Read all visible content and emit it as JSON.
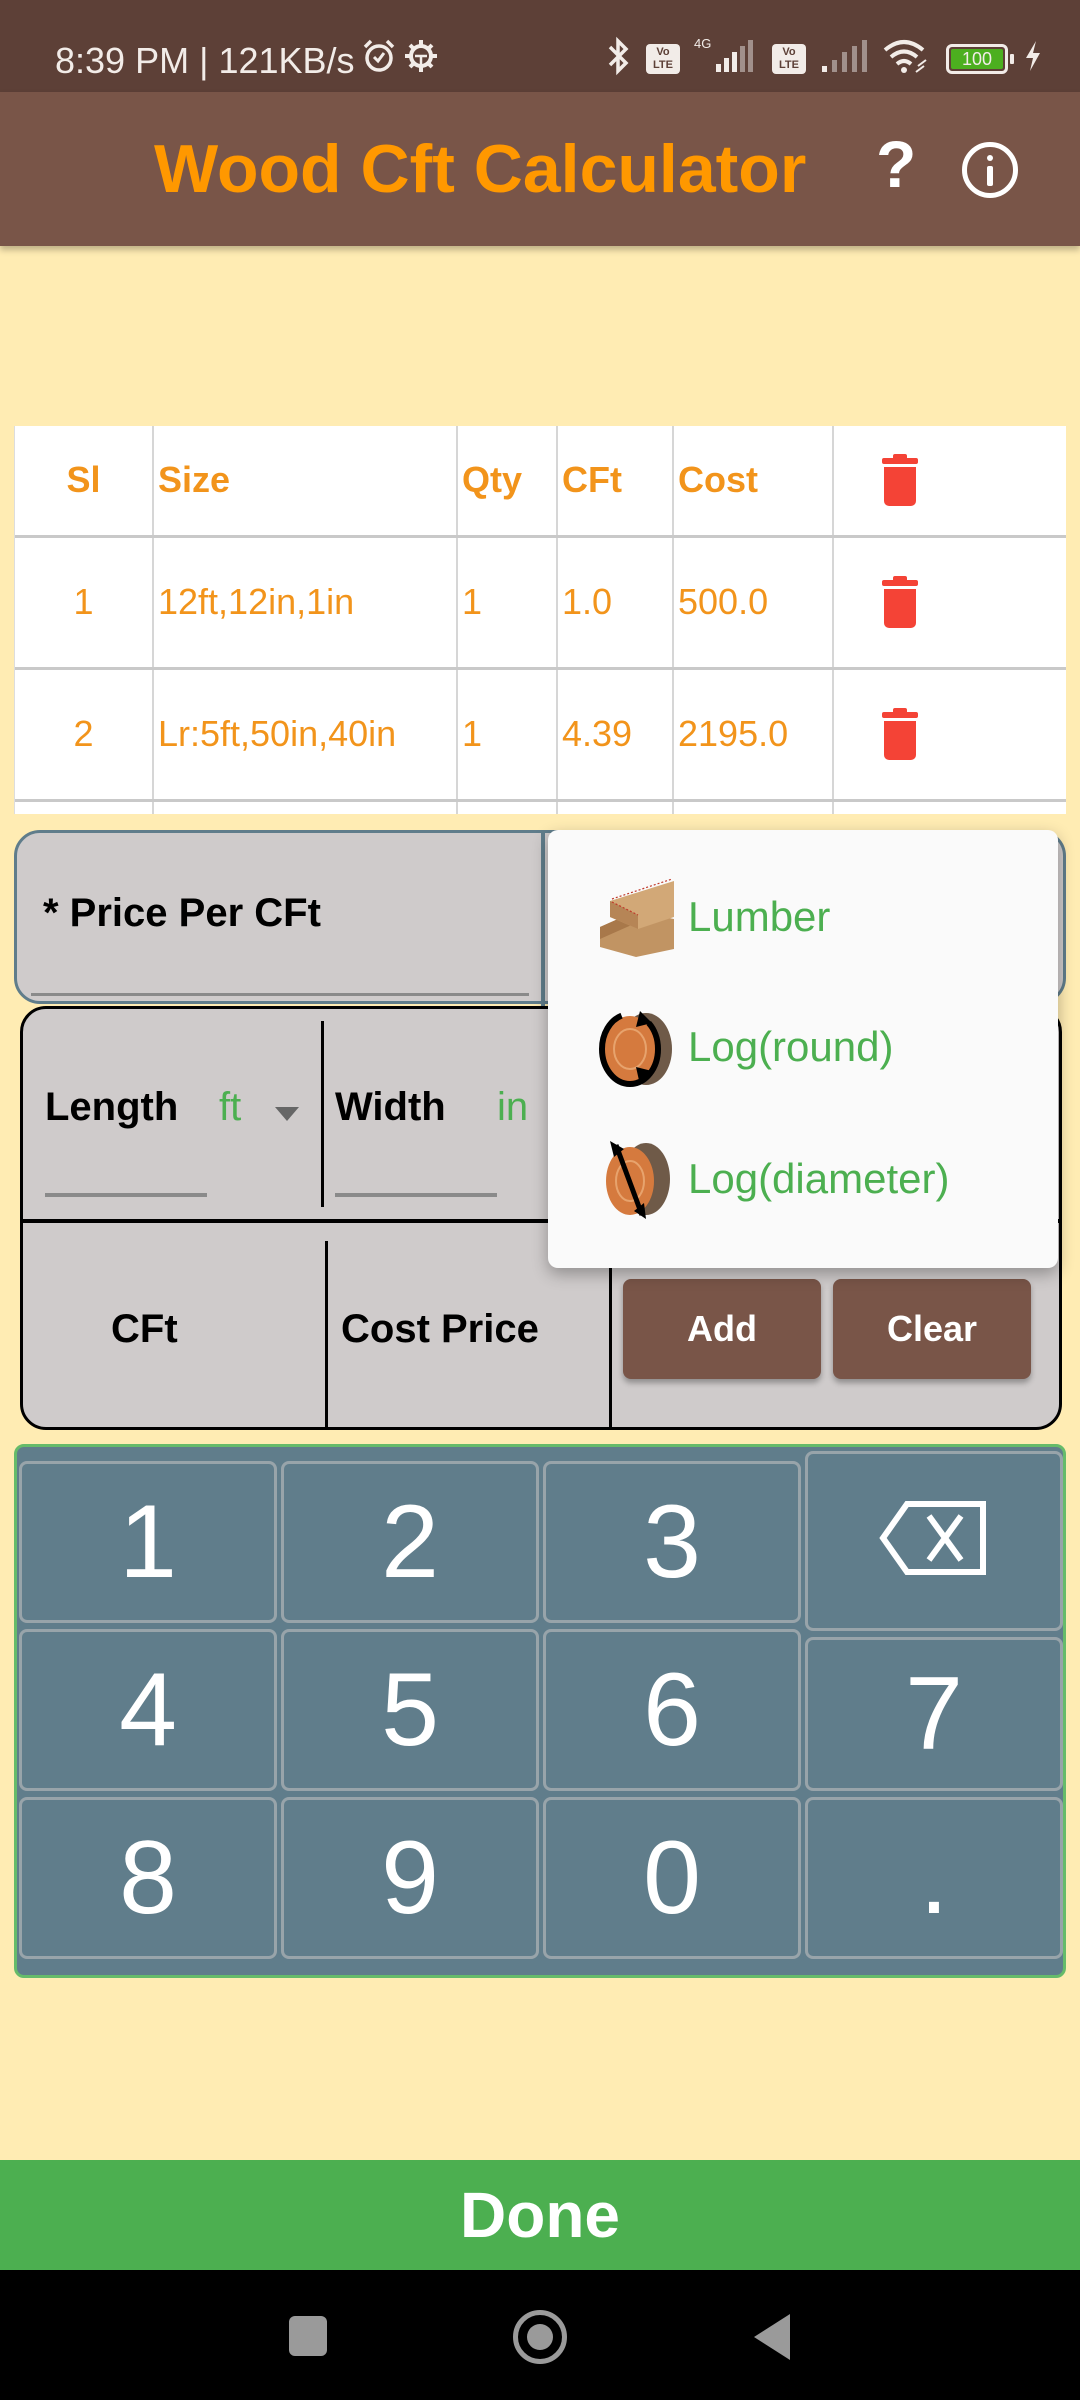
{
  "status_bar": {
    "time": "8:39 PM",
    "separator": "|",
    "network_speed": "121KB/s",
    "left_icons": [
      "alarm-icon",
      "android-debug-icon"
    ],
    "right_icons": [
      "bluetooth-icon",
      "volte-icon",
      "4g-signal-icon",
      "volte-icon",
      "signal-icon",
      "wifi-icon",
      "battery-icon",
      "charging-icon"
    ],
    "network_type": "4G",
    "volte_label_top": "Vo",
    "volte_label_bottom": "LTE",
    "battery_level": "100"
  },
  "app_bar": {
    "title": "Wood Cft Calculator",
    "help_label": "?",
    "help_icon": "help-icon",
    "info_icon": "info-icon"
  },
  "table": {
    "columns": [
      "Sl",
      "Size",
      "Qty",
      "CFt",
      "Cost"
    ],
    "delete_all_icon": "trash-icon",
    "rows": [
      {
        "sl": "1",
        "size": "12ft,12in,1in",
        "qty": "1",
        "cft": "1.0",
        "cost": "500.0"
      },
      {
        "sl": "2",
        "size": "Lr:5ft,50in,40in",
        "qty": "1",
        "cft": "4.39",
        "cost": "2195.0"
      }
    ]
  },
  "price_panel": {
    "label": "* Price Per CFt"
  },
  "dimensions": {
    "length_label": "Length",
    "length_unit": "ft",
    "width_label": "Width",
    "width_unit": "in"
  },
  "results": {
    "cft_label": "CFt",
    "cost_price_label": "Cost Price",
    "add_label": "Add",
    "clear_label": "Clear"
  },
  "wood_type_menu": {
    "items": [
      {
        "label": "Lumber",
        "icon": "lumber-icon"
      },
      {
        "label": "Log(round)",
        "icon": "log-round-icon"
      },
      {
        "label": "Log(diameter)",
        "icon": "log-diameter-icon"
      }
    ]
  },
  "keypad": {
    "keys": [
      "1",
      "2",
      "3",
      "backspace",
      "4",
      "5",
      "6",
      "7",
      "8",
      "9",
      "0",
      "."
    ],
    "backspace_icon": "backspace-icon"
  },
  "done_label": "Done",
  "nav_bar": {
    "icons": [
      "recent-apps-icon",
      "home-icon",
      "back-icon"
    ]
  },
  "colors": {
    "status_bar": "#5D4037",
    "app_bar": "#795548",
    "title": "#FF9800",
    "background": "#FFECB3",
    "table_text": "#F2941B",
    "delete": "#F44336",
    "panel": "#CFCBCB",
    "unit_green": "#4CAF50",
    "keypad": "#607D8B",
    "done": "#4CAF50"
  }
}
